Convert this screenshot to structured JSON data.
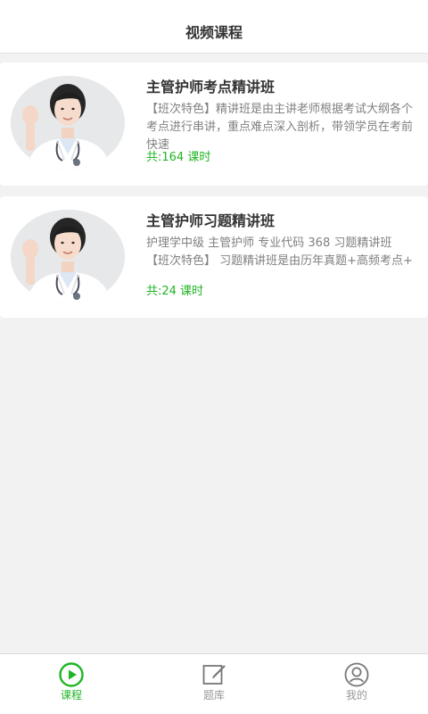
{
  "header": {
    "title": "视频课程"
  },
  "courses": [
    {
      "title": "主管护师考点精讲班",
      "description": "【班次特色】精讲班是由主讲老师根据考试大纲各个考点进行串讲，重点难点深入剖析，带领学员在考前快速",
      "count": "共:164 课时"
    },
    {
      "title": "主管护师习题精讲班",
      "description": "护理学中级 主管护师 专业代码 368 习题精讲班【班次特色】 习题精讲班是由历年真题+高频考点+",
      "count": "共:24 课时"
    }
  ],
  "tabbar": {
    "items": [
      {
        "label": "课程",
        "icon": "play-circle-icon",
        "active": true
      },
      {
        "label": "题库",
        "icon": "edit-note-icon",
        "active": false
      },
      {
        "label": "我的",
        "icon": "user-circle-icon",
        "active": false
      }
    ]
  },
  "colors": {
    "accent": "#1fb524",
    "background": "#f2f2f2",
    "card": "#ffffff",
    "muted_text": "#808080"
  }
}
